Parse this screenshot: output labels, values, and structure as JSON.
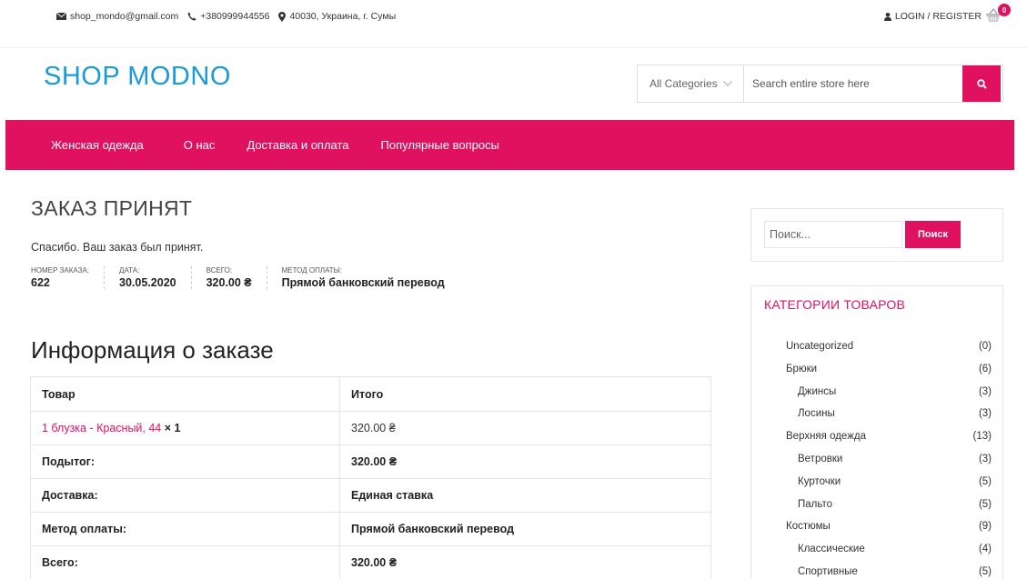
{
  "topbar": {
    "email": "shop_mondo@gmail.com",
    "phone": "+380999944556",
    "address": "40030, Украина, г. Сумы",
    "account_label": "LOGIN / REGISTER",
    "cart_count": "0",
    "icons": {
      "email": "envelope-icon",
      "phone": "phone-icon",
      "address": "map-marker-icon",
      "account": "user-icon",
      "cart": "basket-icon"
    }
  },
  "header": {
    "logo": "SHOP MODNO",
    "category_select": "All Categories",
    "search_placeholder": "Search entire store here"
  },
  "nav": {
    "items": [
      "Женская одежда",
      "О нас",
      "Доставка и оплата",
      "Популярные вопросы"
    ]
  },
  "order": {
    "title": "ЗАКАЗ ПРИНЯТ",
    "thanks": "Спасибо. Ваш заказ был принят.",
    "overview": [
      {
        "label": "НОМЕР ЗАКАЗА:",
        "value": "622"
      },
      {
        "label": "ДАТА:",
        "value": "30.05.2020"
      },
      {
        "label": "ВСЕГО:",
        "value": "320.00 ₴"
      },
      {
        "label": "МЕТОД ОПЛАТЫ:",
        "value": "Прямой банковский перевод"
      }
    ],
    "details_title": "Информация о заказе",
    "table": {
      "headers": [
        "Товар",
        "Итого"
      ],
      "product_link": "1 блузка - Красный, 44",
      "product_qty": "× 1",
      "product_total": "320.00 ₴",
      "rows": [
        {
          "label": "Подытог:",
          "value": "320.00 ₴"
        },
        {
          "label": "Доставка:",
          "value": "Единая ставка"
        },
        {
          "label": "Метод оплаты:",
          "value": "Прямой банковский перевод"
        },
        {
          "label": "Всего:",
          "value": "320.00 ₴"
        }
      ]
    }
  },
  "sidebar": {
    "search_placeholder": "Поиск...",
    "search_button": "Поиск",
    "categories_title": "КАТЕГОРИИ ТОВАРОВ",
    "categories": [
      {
        "name": "Uncategorized",
        "count": "(0)"
      },
      {
        "name": "Брюки",
        "count": "(6)"
      },
      {
        "name": "Джинсы",
        "count": "(3)"
      },
      {
        "name": "Лосины",
        "count": "(3)"
      },
      {
        "name": "Верхняя одежда",
        "count": "(13)"
      },
      {
        "name": "Ветровки",
        "count": "(3)"
      },
      {
        "name": "Курточки",
        "count": "(5)"
      },
      {
        "name": "Пальто",
        "count": "(5)"
      },
      {
        "name": "Костюмы",
        "count": "(9)"
      },
      {
        "name": "Классические",
        "count": "(4)"
      },
      {
        "name": "Спортивные",
        "count": "(5)"
      }
    ]
  },
  "colors": {
    "accent": "#e0115f",
    "logo": "#1a9ad9"
  }
}
